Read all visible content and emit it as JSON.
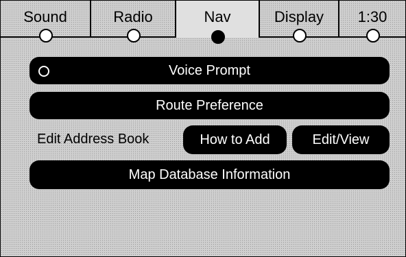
{
  "tabs": [
    {
      "label": "Sound",
      "active": false
    },
    {
      "label": "Radio",
      "active": false
    },
    {
      "label": "Nav",
      "active": true
    },
    {
      "label": "Display",
      "active": false
    },
    {
      "label": "1:30",
      "active": false
    }
  ],
  "nav_menu": {
    "voice_prompt": "Voice Prompt",
    "route_preference": "Route Preference",
    "edit_address_book": "Edit Address Book",
    "how_to_add": "How to Add",
    "edit_view": "Edit/View",
    "map_database_information": "Map Database Information"
  },
  "colors": {
    "button": "#000000",
    "button_text": "#ffffff"
  }
}
